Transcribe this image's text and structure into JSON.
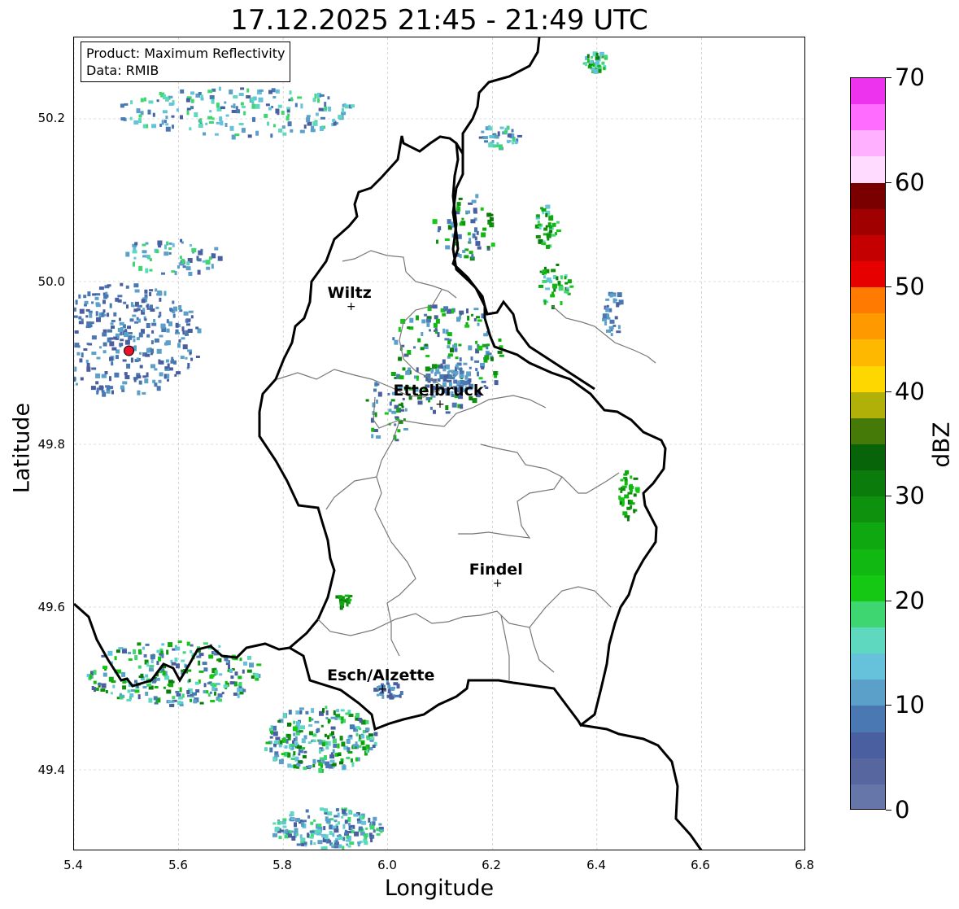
{
  "title": "17.12.2025 21:45 - 21:49 UTC",
  "info": {
    "product": "Product: Maximum Reflectivity",
    "data": "Data: RMIB"
  },
  "axes": {
    "xlabel": "Longitude",
    "ylabel": "Latitude",
    "x_ticks": [
      "5.4",
      "5.6",
      "5.8",
      "6.0",
      "6.2",
      "6.4",
      "6.6",
      "6.8"
    ],
    "y_ticks": [
      "50.2",
      "50.0",
      "49.8",
      "49.6",
      "49.4"
    ],
    "x_range": [
      5.4,
      6.8
    ],
    "y_range": [
      49.3,
      50.3
    ],
    "grid": true
  },
  "colorbar": {
    "label": "dBZ",
    "ticks": [
      "0",
      "10",
      "20",
      "30",
      "40",
      "50",
      "60",
      "70"
    ],
    "range": [
      0,
      70
    ],
    "colors": [
      "#6676a8",
      "#5866a0",
      "#4a5fa0",
      "#4a78b2",
      "#5aa0c8",
      "#66c2da",
      "#5fd8c0",
      "#3ed670",
      "#14c814",
      "#12b812",
      "#10a810",
      "#0e920e",
      "#0b7c0b",
      "#086408",
      "#467a08",
      "#b0b008",
      "#ffd700",
      "#ffb800",
      "#ff9900",
      "#ff7a00",
      "#e60000",
      "#c40000",
      "#a00000",
      "#7a0000",
      "#ffdcff",
      "#ffb0ff",
      "#ff6cff",
      "#ee33ee"
    ]
  },
  "cities": [
    {
      "name": "Wiltz",
      "lon": 5.93,
      "lat": 49.97
    },
    {
      "name": "Ettelbruck",
      "lon": 6.1,
      "lat": 49.85
    },
    {
      "name": "Findel",
      "lon": 6.21,
      "lat": 49.63
    },
    {
      "name": "Esch/Alzette",
      "lon": 5.99,
      "lat": 49.5
    }
  ],
  "radar_site": {
    "lon": 5.505,
    "lat": 49.915,
    "color": "#e8102a"
  }
}
